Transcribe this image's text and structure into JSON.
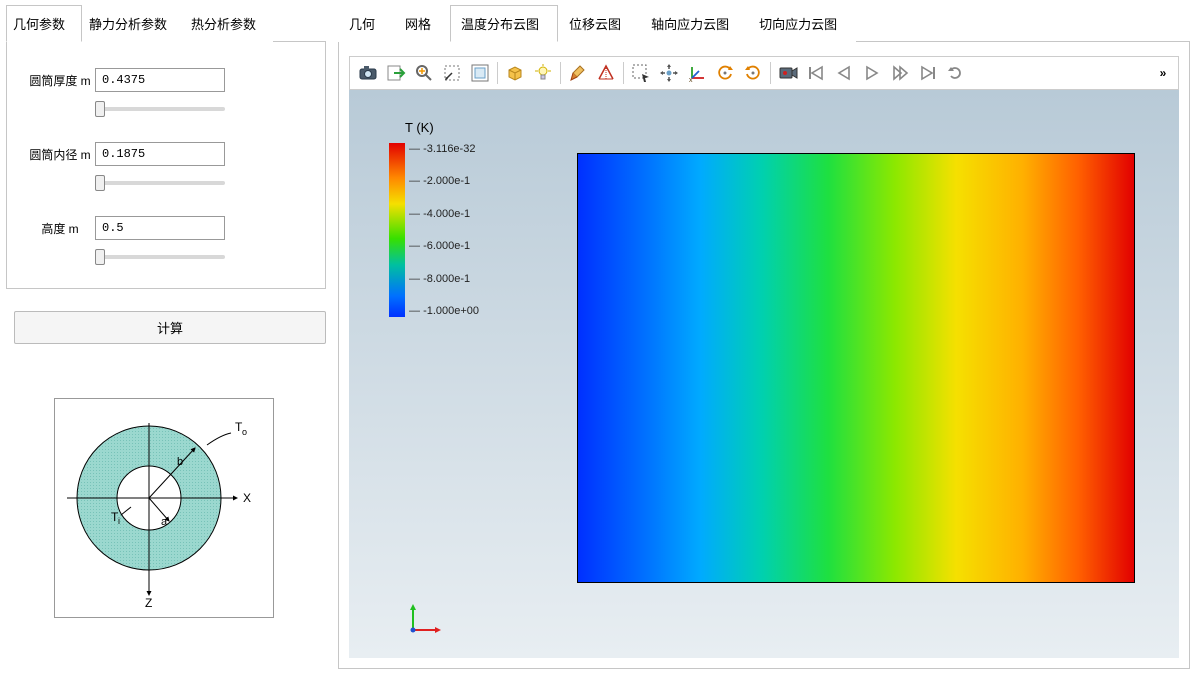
{
  "left_tabs": {
    "geometry": "几何参数",
    "static": "静力分析参数",
    "thermal": "热分析参数",
    "active_index": 0
  },
  "params": {
    "thickness": {
      "label": "圆筒厚度 m",
      "value": "0.4375"
    },
    "inner_radius": {
      "label": "圆筒内径 m",
      "value": "0.1875"
    },
    "height": {
      "label": "高度 m",
      "value": "0.5"
    }
  },
  "compute_label": "计算",
  "diagram": {
    "T_o": "T",
    "T_o_sub": "o",
    "T_i": "T",
    "T_i_sub": "i",
    "a": "a",
    "b": "b",
    "X": "X",
    "Z": "Z"
  },
  "right_tabs": {
    "geometry": "几何",
    "mesh": "网格",
    "temp": "温度分布云图",
    "disp": "位移云图",
    "axial": "轴向应力云图",
    "tangential": "切向应力云图",
    "active_index": 2
  },
  "toolbar_icons": {
    "camera": "camera-icon",
    "export": "export-icon",
    "zoom": "zoom-icon",
    "rubber_band": "rubber-band-select-icon",
    "fit": "fit-window-icon",
    "box_zoom": "box-zoom-icon",
    "light": "light-icon",
    "clean": "clean-icon",
    "measure": "measure-icon",
    "select_box": "select-box-icon",
    "pan": "pan-icon",
    "axes": "axes-icon",
    "rotate_ccw": "rotate-ccw-icon",
    "rotate_cw": "rotate-cw-icon",
    "record": "video-record-icon",
    "first": "first-frame-icon",
    "prev": "prev-frame-icon",
    "play": "play-icon",
    "next": "next-frame-icon",
    "last": "last-frame-icon",
    "loop": "loop-icon",
    "more": "»"
  },
  "legend": {
    "title": "T (K)",
    "ticks": [
      "-3.116e-32",
      "-2.000e-1",
      "-4.000e-1",
      "-6.000e-1",
      "-8.000e-1",
      "-1.000e+00"
    ]
  },
  "chart_data": {
    "type": "heatmap",
    "title": "T (K)",
    "colorbar_label": "T (K)",
    "range": [
      -1.0,
      -3.116e-32
    ],
    "ticks": [
      -3.116e-32,
      -0.2,
      -0.4,
      -0.6,
      -0.8,
      -1.0
    ],
    "orientation": "horizontal-gradient",
    "note": "2D contour plot of temperature; value varies monotonically left (min, blue) to right (max, red) across the rectangular domain"
  }
}
